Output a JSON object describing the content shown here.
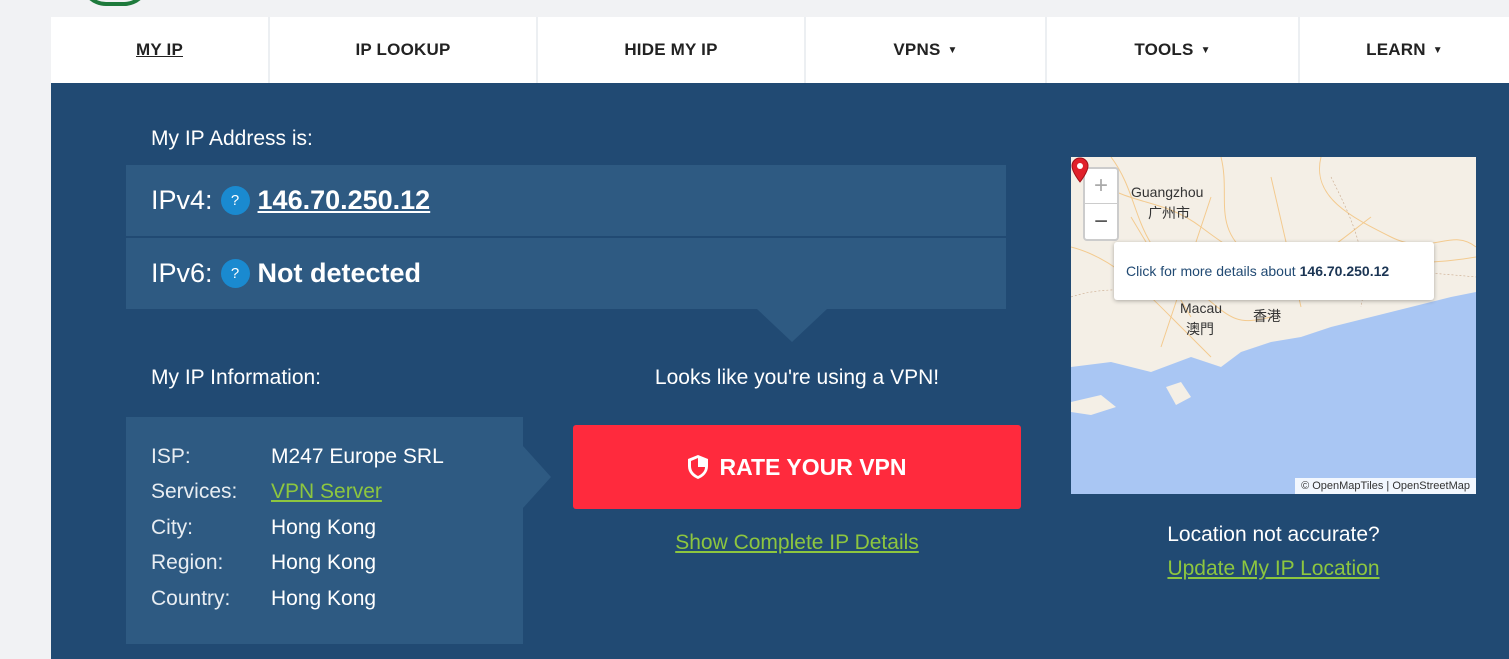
{
  "nav": {
    "items": [
      {
        "label": "MY IP",
        "dropdown": false,
        "active": true
      },
      {
        "label": "IP LOOKUP",
        "dropdown": false
      },
      {
        "label": "HIDE MY IP",
        "dropdown": false
      },
      {
        "label": "VPNS",
        "dropdown": true
      },
      {
        "label": "TOOLS",
        "dropdown": true
      },
      {
        "label": "LEARN",
        "dropdown": true
      }
    ],
    "caret": "▼"
  },
  "ip": {
    "heading": "My IP Address is:",
    "v4_label": "IPv4:",
    "v4_value": "146.70.250.12",
    "v6_label": "IPv6:",
    "v6_value": "Not detected",
    "help_glyph": "?"
  },
  "info": {
    "heading": "My IP Information:",
    "rows": [
      {
        "key": "ISP:",
        "value": "M247 Europe SRL"
      },
      {
        "key": "Services:",
        "value": "VPN Server"
      },
      {
        "key": "City:",
        "value": "Hong Kong"
      },
      {
        "key": "Region:",
        "value": "Hong Kong"
      },
      {
        "key": "Country:",
        "value": "Hong Kong"
      }
    ]
  },
  "vpn": {
    "message": "Looks like you're using a VPN!",
    "rate_button": "RATE YOUR VPN",
    "details_link": "Show Complete IP Details"
  },
  "map": {
    "zoom_in": "+",
    "zoom_out": "−",
    "popup_text": "Click for more details about",
    "popup_ip": "146.70.250.12",
    "labels": {
      "guangzhou": "Guangzhou",
      "guangzhou_cn": "广州市",
      "macau": "Macau",
      "macau_cn": "澳門",
      "hk_cn": "香港"
    },
    "attribution": "© OpenMapTiles | OpenStreetMap"
  },
  "location": {
    "question": "Location not accurate?",
    "update_link": "Update My IP Location"
  },
  "colors": {
    "panel": "#214a73",
    "row": "#2e5a82",
    "accent_red": "#ff2a3d",
    "link_green": "#8dc63f",
    "help_blue": "#1a8ad0"
  }
}
